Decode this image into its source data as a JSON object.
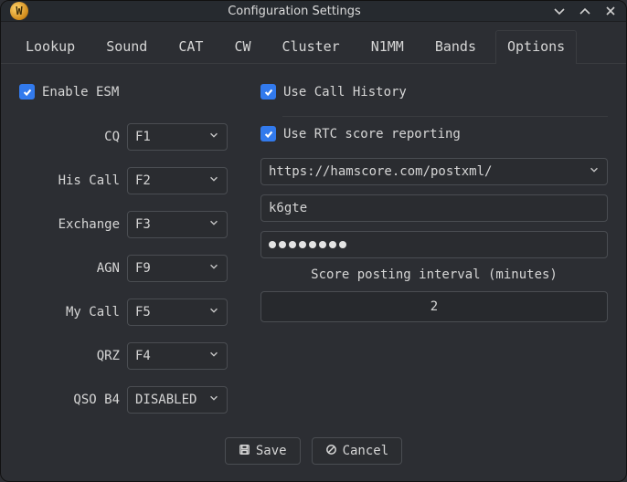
{
  "window": {
    "title": "Configuration Settings"
  },
  "tabs": {
    "t0": "Lookup",
    "t1": "Sound",
    "t2": "CAT",
    "t3": "CW",
    "t4": "Cluster",
    "t5": "N1MM",
    "t6": "Bands",
    "t7": "Options"
  },
  "left": {
    "enable_esm_label": "Enable ESM",
    "cq_label": "CQ",
    "cq_value": "F1",
    "his_call_label": "His Call",
    "his_call_value": "F2",
    "exchange_label": "Exchange",
    "exchange_value": "F3",
    "agn_label": "AGN",
    "agn_value": "F9",
    "my_call_label": "My Call",
    "my_call_value": "F5",
    "qrz_label": "QRZ",
    "qrz_value": "F4",
    "qso_b4_label": "QSO B4",
    "qso_b4_value": "DISABLED"
  },
  "right": {
    "use_call_history_label": "Use Call History",
    "use_rtc_label": "Use RTC score reporting",
    "rtc_url": "https://hamscore.com/postxml/",
    "rtc_user": "k6gte",
    "rtc_pass_len": 8,
    "interval_label": "Score posting interval (minutes)",
    "interval_value": "2"
  },
  "footer": {
    "save_label": "Save",
    "cancel_label": "Cancel"
  }
}
